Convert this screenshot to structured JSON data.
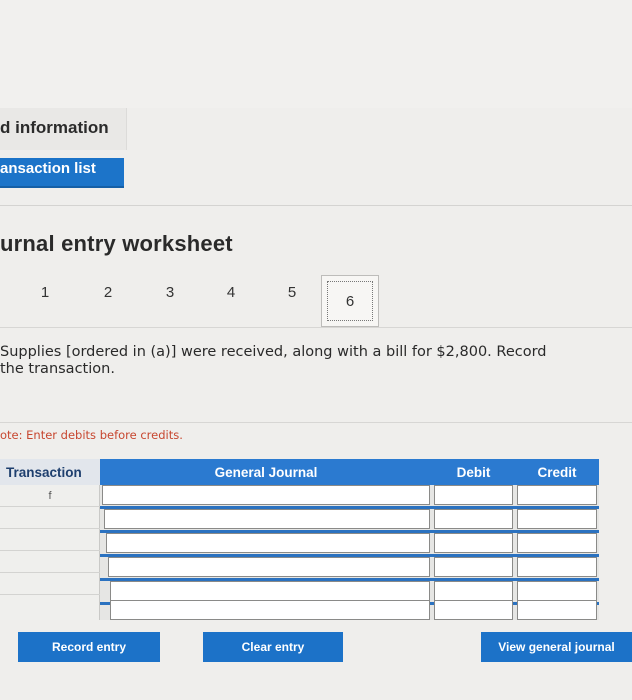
{
  "tabs": {
    "info": "d information",
    "transaction_list": "ansaction list"
  },
  "worksheet": {
    "title": "urnal entry worksheet",
    "steps": [
      "1",
      "2",
      "3",
      "4",
      "5",
      "6"
    ],
    "active_step": "6"
  },
  "question": {
    "line1": "Supplies [ordered in (a)] were received, along with a bill for $2,800. Record",
    "line2": "the transaction."
  },
  "note": "ote: Enter debits before credits.",
  "table": {
    "headers": {
      "transaction": "Transaction",
      "general_journal": "General Journal",
      "debit": "Debit",
      "credit": "Credit"
    },
    "transaction_value": "f"
  },
  "buttons": {
    "record": "Record entry",
    "clear": "Clear entry",
    "view": "View general journal"
  },
  "colors": {
    "accent": "#1c72c8",
    "header": "#2b7ad0",
    "note": "#c7462f"
  }
}
